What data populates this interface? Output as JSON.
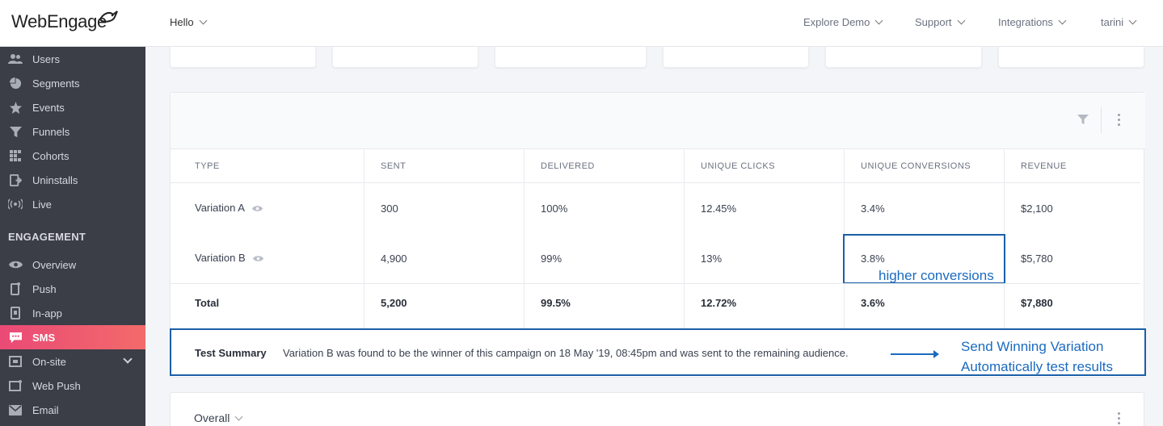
{
  "header": {
    "logo_text": "WebEngage",
    "project": "Hello",
    "nav": [
      "Explore Demo",
      "Support",
      "Integrations",
      "tarini"
    ]
  },
  "sidebar": {
    "items_top": [
      {
        "label": "Users",
        "icon": "users-icon"
      },
      {
        "label": "Segments",
        "icon": "pie-chart-icon"
      },
      {
        "label": "Events",
        "icon": "star-icon"
      },
      {
        "label": "Funnels",
        "icon": "funnel-icon"
      },
      {
        "label": "Cohorts",
        "icon": "grid-icon"
      },
      {
        "label": "Uninstalls",
        "icon": "uninstall-icon"
      },
      {
        "label": "Live",
        "icon": "broadcast-icon"
      }
    ],
    "section_heading": "ENGAGEMENT",
    "items_engagement": [
      {
        "label": "Overview",
        "icon": "eye-icon"
      },
      {
        "label": "Push",
        "icon": "mobile-icon"
      },
      {
        "label": "In-app",
        "icon": "in-app-icon"
      },
      {
        "label": "SMS",
        "icon": "sms-icon",
        "active": true
      },
      {
        "label": "On-site",
        "icon": "on-site-icon",
        "expandable": true
      },
      {
        "label": "Web Push",
        "icon": "web-push-icon"
      },
      {
        "label": "Email",
        "icon": "email-icon"
      }
    ]
  },
  "table": {
    "columns": [
      "TYPE",
      "SENT",
      "DELIVERED",
      "UNIQUE CLICKS",
      "UNIQUE CONVERSIONS",
      "REVENUE"
    ],
    "rows": [
      {
        "type": "Variation A",
        "sent": "300",
        "delivered": "100%",
        "clicks": "12.45%",
        "conversions": "3.4%",
        "revenue": "$2,100"
      },
      {
        "type": "Variation B",
        "sent": "4,900",
        "delivered": "99%",
        "clicks": "13%",
        "conversions": "3.8%",
        "revenue": "$5,780"
      }
    ],
    "total": {
      "type": "Total",
      "sent": "5,200",
      "delivered": "99.5%",
      "clicks": "12.72%",
      "conversions": "3.6%",
      "revenue": "$7,880"
    },
    "annotation": "higher conversions"
  },
  "summary": {
    "title": "Test Summary",
    "text": "Variation B was found to be the winner of this campaign on 18 May '19, 08:45pm and was sent to the remaining audience.",
    "callout_line1": "Send Winning Variation",
    "callout_line2": "Automatically test results"
  },
  "overall": {
    "label": "Overall"
  },
  "colors": {
    "accent": "#1b6bc0",
    "sidebar_bg": "#3b3e47",
    "active_gradient_start": "#e94a76",
    "active_gradient_end": "#f36a6a"
  }
}
